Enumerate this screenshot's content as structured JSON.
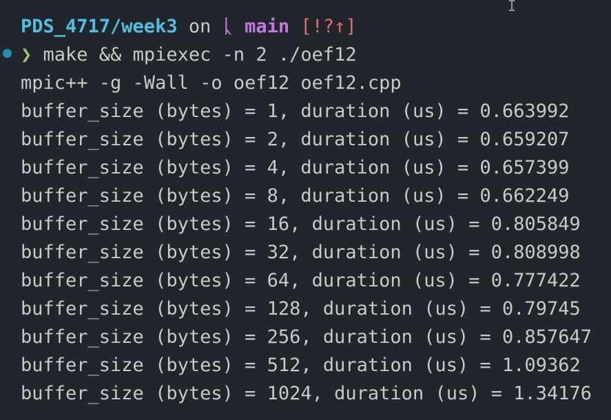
{
  "prompt": {
    "directory": "PDS_4717/week3",
    "on_text": "on",
    "branch_icon": "git-branch-icon",
    "branch_glyph": "ᚳ",
    "branch": "main",
    "git_status": "[!?↑]",
    "chevron": "❯",
    "command": "make && mpiexec -n 2 ./oef12"
  },
  "output": [
    "mpic++ -g -Wall -o oef12 oef12.cpp",
    "buffer_size (bytes) = 1, duration (us) = 0.663992",
    "buffer_size (bytes) = 2, duration (us) = 0.659207",
    "buffer_size (bytes) = 4, duration (us) = 0.657399",
    "buffer_size (bytes) = 8, duration (us) = 0.662249",
    "buffer_size (bytes) = 16, duration (us) = 0.805849",
    "buffer_size (bytes) = 32, duration (us) = 0.808998",
    "buffer_size (bytes) = 64, duration (us) = 0.777422",
    "buffer_size (bytes) = 128, duration (us) = 0.79745",
    "buffer_size (bytes) = 256, duration (us) = 0.857647",
    "buffer_size (bytes) = 512, duration (us) = 1.09362",
    "buffer_size (bytes) = 1024, duration (us) = 1.34176"
  ],
  "colors": {
    "background": "#21262d",
    "text": "#c9c9c9",
    "directory": "#4fc1e0",
    "branch": "#c678dd",
    "status": "#e06c75",
    "chevron": "#98c379",
    "dot": "#1f8fb5"
  }
}
